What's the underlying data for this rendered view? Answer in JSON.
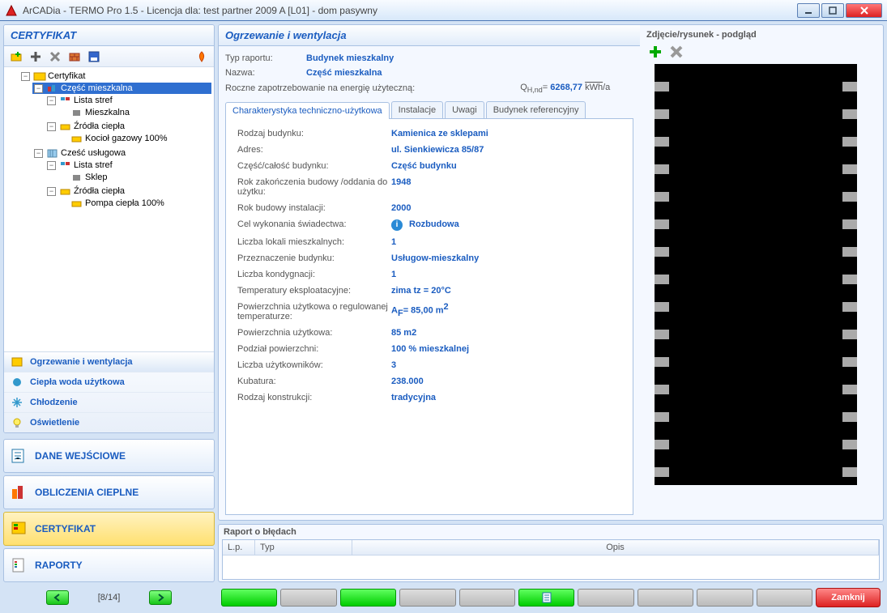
{
  "window": {
    "title": "ArCADia - TERMO Pro 1.5 - Licencja dla: test partner 2009 A [L01] - dom pasywny"
  },
  "sidebar": {
    "header": "CERTYFIKAT",
    "tree": {
      "root": "Certyfikat",
      "n1": "Część mieszkalna",
      "n1a": "Lista stref",
      "n1a1": "Mieszkalna",
      "n1b": "Źródła ciepła",
      "n1b1": "Kocioł gazowy 100%",
      "n2": "Cześć usługowa",
      "n2a": "Lista stref",
      "n2a1": "Sklep",
      "n2b": "Źródła ciepła",
      "n2b1": "Pompa ciepła 100%"
    },
    "subnav": [
      "Ogrzewanie i wentylacja",
      "Ciepła woda użytkowa",
      "Chłodzenie",
      "Oświetlenie"
    ],
    "bignav": [
      "DANE WEJŚCIOWE",
      "OBLICZENIA CIEPLNE",
      "CERTYFIKAT",
      "RAPORTY"
    ],
    "pager": "[8/14]"
  },
  "main": {
    "header": "Ogrzewanie i wentylacja",
    "row1_lbl": "Typ raportu:",
    "row1_val": "Budynek mieszkalny",
    "row2_lbl": "Nazwa:",
    "row2_val": "Część mieszkalna",
    "row3_lbl": "Roczne zapotrzebowanie na energię użyteczną:",
    "energy_value": "6268,77",
    "tabs": [
      "Charakterystyka techniczno-użytkowa",
      "Instalacje",
      "Uwagi",
      "Budynek referencyjny"
    ],
    "props": [
      {
        "k": "Rodzaj budynku:",
        "v": "Kamienica ze sklepami"
      },
      {
        "k": "Adres:",
        "v": "ul. Sienkiewicza 85/87"
      },
      {
        "k": "Część/całość budynku:",
        "v": "Część budynku"
      },
      {
        "k": "Rok zakończenia budowy /oddania do użytku:",
        "v": "1948"
      },
      {
        "k": "Rok budowy instalacji:",
        "v": "2000"
      },
      {
        "k": "Cel wykonania świadectwa:",
        "v": "Rozbudowa",
        "info": true
      },
      {
        "k": "Liczba lokali mieszkalnych:",
        "v": "1"
      },
      {
        "k": "Przeznaczenie budynku:",
        "v": "Usługow-mieszkalny"
      },
      {
        "k": "Liczba kondygnacji:",
        "v": "1"
      },
      {
        "k": "Temperatury eksploatacyjne:",
        "v": "zima tz = 20°C"
      },
      {
        "k": "Powierzchnia użytkowa o regulowanej temperaturze:",
        "v": "A_F= 85,00 m²",
        "html": "A<sub>F</sub>= 85,00 m<sup>2</sup>"
      },
      {
        "k": "Powierzchnia użytkowa:",
        "v": "85 m2"
      },
      {
        "k": "Podział powierzchni:",
        "v": "100 % mieszkalnej"
      },
      {
        "k": "Liczba użytkowników:",
        "v": "3"
      },
      {
        "k": "Kubatura:",
        "v": "238.000"
      },
      {
        "k": "Rodzaj konstrukcji:",
        "v": "tradycyjna"
      }
    ]
  },
  "preview": {
    "title": "Zdjęcie/rysunek - podgląd"
  },
  "errors": {
    "title": "Raport o błędach",
    "cols": [
      "L.p.",
      "Typ",
      "Opis"
    ]
  },
  "footer": {
    "close": "Zamknij"
  }
}
